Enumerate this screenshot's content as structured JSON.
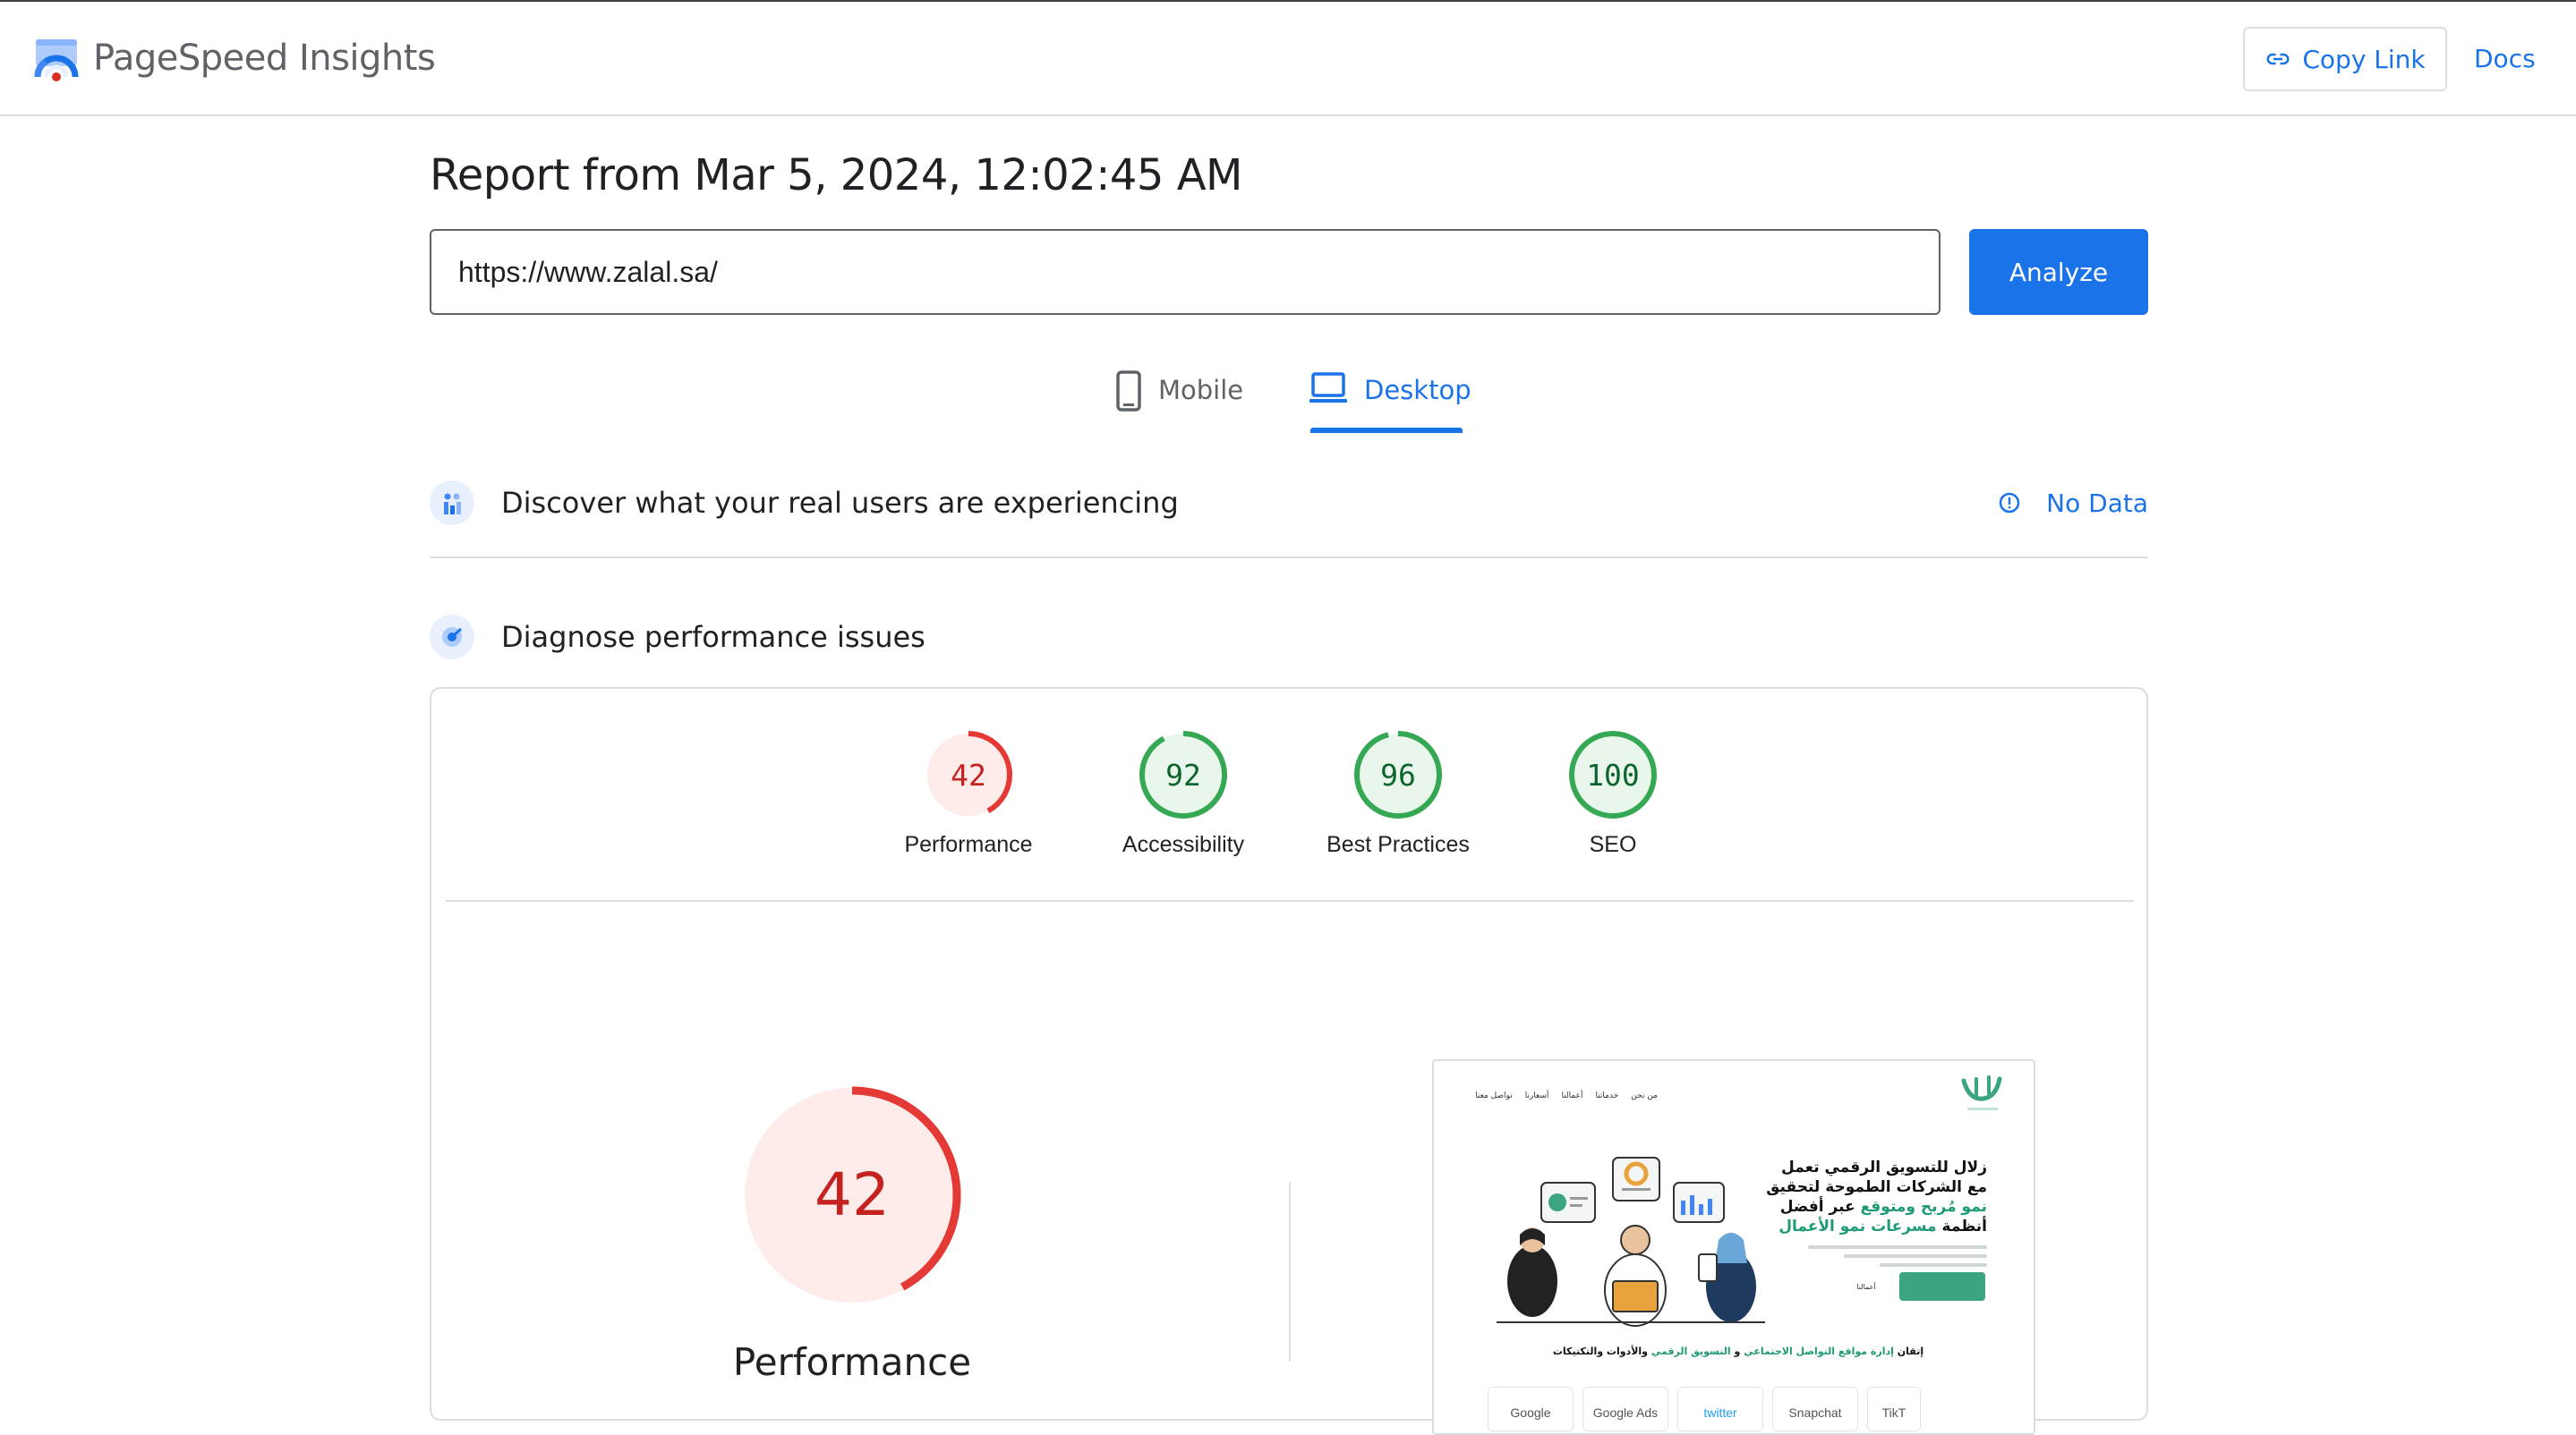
{
  "header": {
    "title": "PageSpeed Insights",
    "copy_link_label": "Copy Link",
    "docs_label": "Docs"
  },
  "report": {
    "title": "Report from Mar 5, 2024, 12:02:45 AM",
    "url_value": "https://www.zalal.sa/",
    "analyze_label": "Analyze"
  },
  "tabs": [
    {
      "label": "Mobile",
      "selected": false,
      "icon": "phone-icon"
    },
    {
      "label": "Desktop",
      "selected": true,
      "icon": "laptop-icon"
    }
  ],
  "real_users": {
    "title": "Discover what your real users are experiencing",
    "status": "No Data",
    "icon": "users-chart-icon"
  },
  "diagnose": {
    "title": "Diagnose performance issues",
    "icon": "lighthouse-icon"
  },
  "scores": [
    {
      "label": "Performance",
      "value": 42,
      "status": "poor"
    },
    {
      "label": "Accessibility",
      "value": 92,
      "status": "good"
    },
    {
      "label": "Best Practices",
      "value": 96,
      "status": "good"
    },
    {
      "label": "SEO",
      "value": 100,
      "status": "good"
    }
  ],
  "performance": {
    "label": "Performance",
    "value": 42
  },
  "colors": {
    "poor": "#e53935",
    "poor_bg": "#fdecea",
    "poor_text": "#c5221f",
    "good": "#34a853",
    "good_bg": "#e9f6ec",
    "good_text": "#0d652d",
    "accent": "#1a73e8"
  },
  "preview": {
    "nav": [
      "من نحن",
      "خدماتنا",
      "أعمالنا",
      "أسعارنا",
      "تواصل معنا"
    ],
    "headline_part1": "زلال للتسويق الرقمي تعمل مع الشركات الطموحة لتحقيق",
    "headline_accent1": "نمو مُربح ومتوقع",
    "headline_part2": "عبر أفضل أنظمة",
    "headline_accent2": "مسرعات نمو الأعمال",
    "cta_secondary": "أعمالنا",
    "line_part1": "إتقان",
    "line_accent1": "إدارة مواقع التواصل الاجتماعي",
    "line_part2": "و",
    "line_accent2": "التسويق الرقمي",
    "line_part3": "والأدوات والتكتيكات",
    "brands": [
      "Google",
      "Google Ads",
      "twitter",
      "Snapchat",
      "TikT"
    ]
  }
}
